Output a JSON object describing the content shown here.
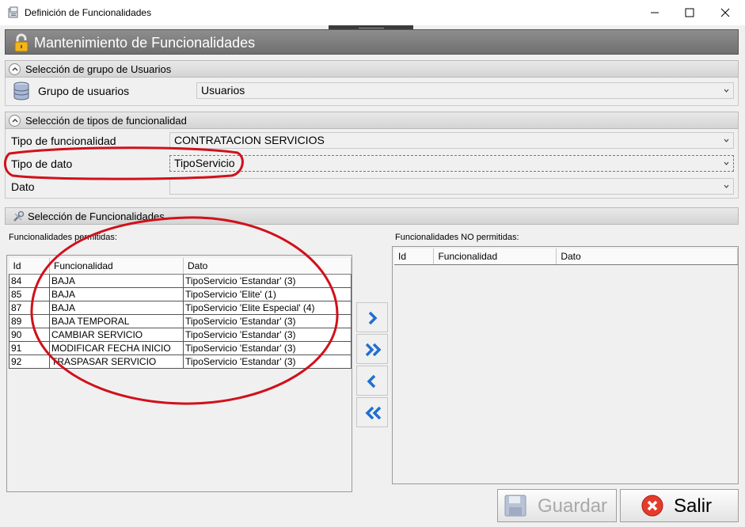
{
  "window": {
    "title": "Definición de Funcionalidades",
    "controls": [
      "minimize",
      "maximize",
      "close"
    ]
  },
  "main_header": {
    "title": "Mantenimiento de Funcionalidades",
    "icon": "lock-icon"
  },
  "section_groups": {
    "title": "Selección de grupo de Usuarios",
    "group_label": "Grupo de usuarios",
    "group_value": "Usuarios"
  },
  "section_types": {
    "title": "Selección de tipos de funcionalidad",
    "tipo_funcionalidad_label": "Tipo de funcionalidad",
    "tipo_funcionalidad_value": "CONTRATACION SERVICIOS",
    "tipo_dato_label": "Tipo de dato",
    "tipo_dato_value": "TipoServicio",
    "dato_label": "Dato",
    "dato_value": ""
  },
  "section_funcs": {
    "title": "Selección de Funcionalidades",
    "allowed_label": "Funcionalidades permitidas:",
    "denied_label": "Funcionalidades NO permitidas:",
    "columns": [
      "Id",
      "Funcionalidad",
      "Dato"
    ],
    "allowed_rows": [
      [
        "84",
        "BAJA",
        "TipoServicio 'Estandar' (3)"
      ],
      [
        "85",
        "BAJA",
        "TipoServicio 'Elite' (1)"
      ],
      [
        "87",
        "BAJA",
        "TipoServicio 'Elite Especial' (4)"
      ],
      [
        "89",
        "BAJA TEMPORAL",
        "TipoServicio 'Estandar' (3)"
      ],
      [
        "90",
        "CAMBIAR SERVICIO",
        "TipoServicio 'Estandar' (3)"
      ],
      [
        "91",
        "MODIFICAR FECHA INICIO",
        "TipoServicio 'Estandar' (3)"
      ],
      [
        "92",
        "TRASPASAR SERVICIO",
        "TipoServicio 'Estandar' (3)"
      ]
    ],
    "denied_rows": []
  },
  "buttons": {
    "save": "Guardar",
    "exit": "Salir",
    "save_enabled": false
  },
  "colors": {
    "header_bg": "#7f7f7f",
    "move_arrow": "#1f6fd1",
    "annotation": "#d0111b",
    "exit_icon": "#e53b2c"
  }
}
